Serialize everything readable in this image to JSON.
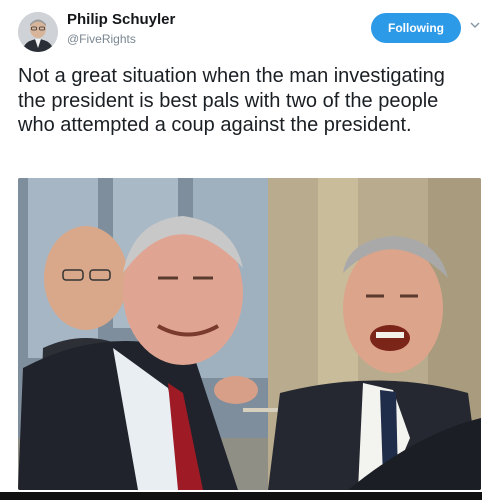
{
  "header": {
    "display_name": "Philip Schuyler",
    "handle": "@FiveRights",
    "follow_label": "Following"
  },
  "tweet": {
    "text": "Not a great situation when the man investigating the president is best pals with two of the people who attempted a coup against the president."
  },
  "icons": {
    "avatar": "profile-avatar",
    "menu": "chevron-down-icon"
  },
  "colors": {
    "accent": "#2d9ae8",
    "text": "#1a1f24",
    "secondary": "#7a8690"
  }
}
